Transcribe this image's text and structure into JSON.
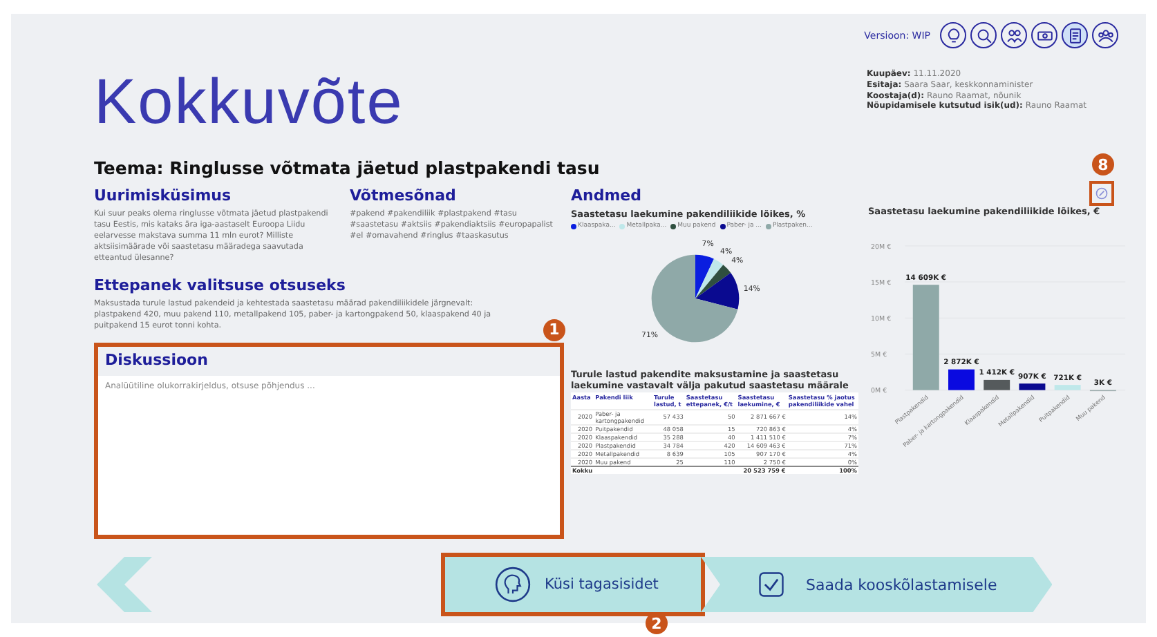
{
  "version": {
    "label": "Versioon:",
    "value": "WIP"
  },
  "toolbar": [
    {
      "kind": "bulb",
      "selected": false
    },
    {
      "kind": "search",
      "selected": false
    },
    {
      "kind": "people",
      "selected": false
    },
    {
      "kind": "money",
      "selected": false
    },
    {
      "kind": "document",
      "selected": true
    },
    {
      "kind": "group",
      "selected": false
    }
  ],
  "meta": [
    {
      "label": "Kuupäev:",
      "value": "11.11.2020"
    },
    {
      "label": "Esitaja:",
      "value": "Saara Saar, keskkonnaminister"
    },
    {
      "label": "Koostaja(d):",
      "value": "Rauno Raamat, nõunik"
    },
    {
      "label": "Nõupidamisele kutsutud isik(ud):",
      "value": "Rauno Raamat"
    }
  ],
  "title": "Kokkuvõte",
  "topic": "Teema: Ringlusse võtmata jäetud plastpakendi tasu",
  "research": {
    "heading": "Uurimisküsimus",
    "text": "Kui suur peaks olema ringlusse võtmata jäetud plastpakendi tasu Eestis, mis kataks ära iga-aastaselt Euroopa Liidu eelarvesse makstava summa 11 mln eurot? Milliste aktsiisimäärade või saastetasu määradega saavutada etteantud ülesanne?"
  },
  "keywords": {
    "heading": "Võtmesõnad",
    "text": "#pakend #pakendiliik #plastpakend #tasu #saastetasu #aktsiis #pakendiaktsiis #europapalist #el #omavahend #ringlus #taaskasutus"
  },
  "proposal": {
    "heading": "Ettepanek valitsuse otsuseks",
    "text": "Maksustada turule lastud pakendeid ja kehtestada saastetasu määrad pakendiliikidele järgnevalt: plastpakend 420, muu pakend 110, metallpakend 105, paber- ja kartongpakend 50, klaaspakend 40 ja puitpakend 15 eurot tonni kohta."
  },
  "discussion": {
    "heading": "Diskussioon",
    "placeholder": "Analüütiline olukorrakirjeldus, otsuse põhjendus ..."
  },
  "data": {
    "heading": "Andmed",
    "pie": {
      "chart_data": {
        "type": "pie",
        "title": "Saastetasu laekumine pakendiliikide lõikes, %",
        "categories": [
          "Klaaspaka...",
          "Metallpaka...",
          "Muu pakend",
          "Paber- ja ...",
          "Plastpaken..."
        ],
        "values": [
          7,
          4,
          4,
          14,
          71
        ],
        "colors": [
          "#0a1ee0",
          "#bfe8ea",
          "#2f4f3f",
          "#0a0a90",
          "#8fa9a8"
        ],
        "value_labels": [
          "7%",
          "4%",
          "4%",
          "14%",
          "71%"
        ]
      }
    },
    "table": {
      "title": "Turule lastud pakendite maksustamine ja saastetasu laekumine vastavalt välja pakutud saastetasu määrale",
      "columns": [
        "Aasta",
        "Pakendi liik",
        "Turule lastud, t",
        "Saastetasu ettepanek, €/t",
        "Saastetasu laekumine, €",
        "Saastetasu % jaotus pakendiliikide vahel"
      ],
      "rows": [
        [
          "2020",
          "Paber- ja kartongpakendid",
          "57 433",
          "50",
          "2 871 667 €",
          "14%"
        ],
        [
          "2020",
          "Puitpakendid",
          "48 058",
          "15",
          "720 863 €",
          "4%"
        ],
        [
          "2020",
          "Klaaspakendid",
          "35 288",
          "40",
          "1 411 510 €",
          "7%"
        ],
        [
          "2020",
          "Plastpakendid",
          "34 784",
          "420",
          "14 609 463 €",
          "71%"
        ],
        [
          "2020",
          "Metallpakendid",
          "8 639",
          "105",
          "907 170 €",
          "4%"
        ],
        [
          "2020",
          "Muu pakend",
          "25",
          "110",
          "2 750 €",
          "0%"
        ]
      ],
      "total": {
        "label": "Kokku",
        "sum": "20 523 759 €",
        "share": "100%"
      }
    },
    "bar": {
      "chart_data": {
        "type": "bar",
        "title": "Saastetasu laekumine pakendiliikide lõikes, €",
        "categories": [
          "Plastpakendid",
          "Paber- ja kartongpakendid",
          "Klaaspakendid",
          "Metallpakendid",
          "Puitpakendid",
          "Muu pakend"
        ],
        "values": [
          14609000,
          2872000,
          1412000,
          907000,
          721000,
          3000
        ],
        "grid": true,
        "colors": [
          "#8fa9a8",
          "#0a0ae0",
          "#555a5c",
          "#0a0a90",
          "#bfe8ea",
          "#9aa"
        ],
        "value_labels": [
          "14 609K €",
          "2 872K €",
          "1 412K €",
          "907K €",
          "721K €",
          "3K €"
        ],
        "ylim": [
          0,
          20000000
        ],
        "yticks": [
          {
            "value": 0,
            "label": "0M €"
          },
          {
            "value": 5000000,
            "label": "5M €"
          },
          {
            "value": 10000000,
            "label": "10M €"
          },
          {
            "value": 15000000,
            "label": "15M €"
          },
          {
            "value": 20000000,
            "label": "20M €"
          }
        ]
      }
    }
  },
  "nav": {
    "feedback": "Küsi tagasisidet",
    "approve": "Saada kooskõlastamisele"
  },
  "callouts": [
    {
      "number": "1"
    },
    {
      "number": "2"
    },
    {
      "number": "8"
    }
  ]
}
